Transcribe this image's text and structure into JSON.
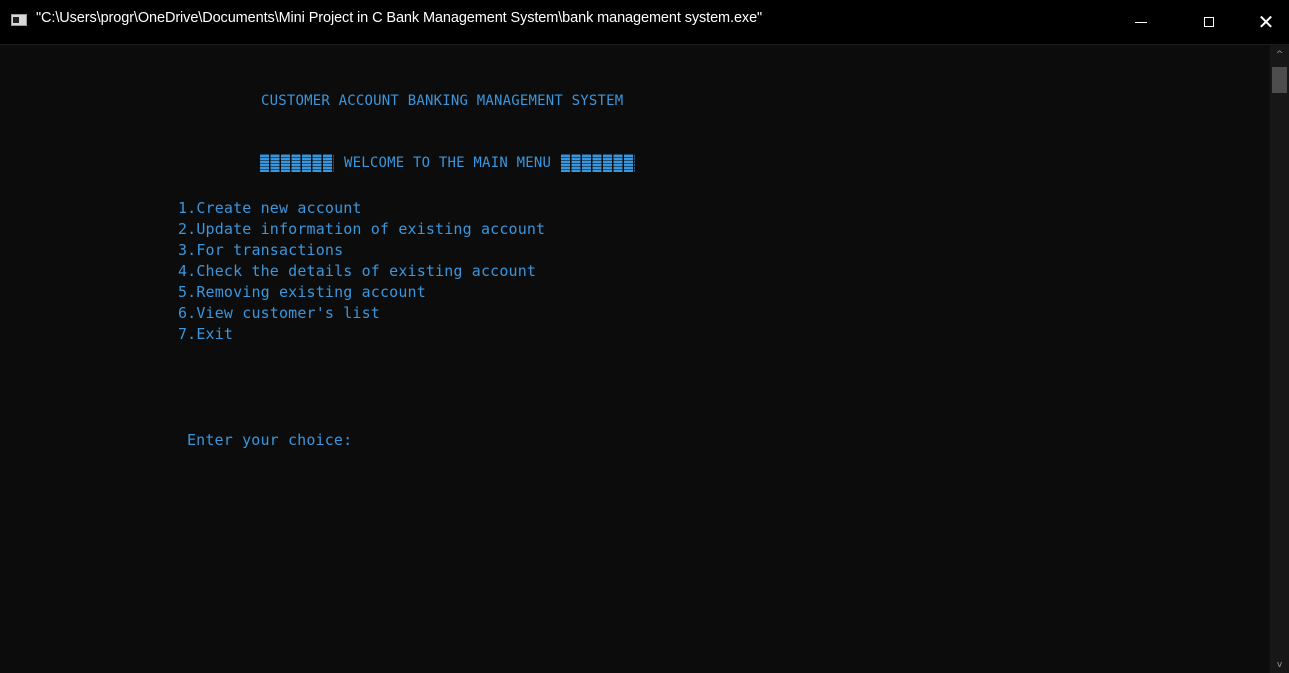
{
  "window": {
    "title": "\"C:\\Users\\progr\\OneDrive\\Documents\\Mini Project in C Bank Management System\\bank management system.exe\"",
    "controls": {
      "minimize": "—",
      "maximize": "☐",
      "close": "✕"
    }
  },
  "console": {
    "heading": "CUSTOMER ACCOUNT BANKING MANAGEMENT SYSTEM",
    "welcome": "WELCOME TO THE MAIN MENU",
    "menu_items": [
      "1.Create new account",
      "2.Update information of existing account",
      "3.For transactions",
      "4.Check the details of existing account",
      "5.Removing existing account",
      "6.View customer's list",
      "7.Exit"
    ],
    "prompt": "Enter your choice:",
    "text_color": "#3a96dd",
    "background_color": "#0c0c0c"
  },
  "scrollbar": {
    "up_arrow": "^",
    "down_arrow": "v"
  },
  "icons": {
    "app": "console-window-icon",
    "minimize": "minimize-icon",
    "maximize": "maximize-icon",
    "close": "close-icon"
  }
}
